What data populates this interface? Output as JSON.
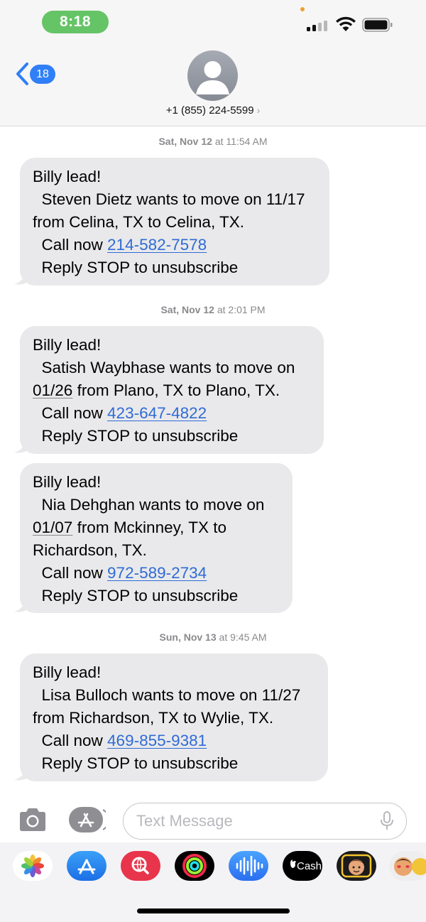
{
  "status_bar": {
    "time": "8:18"
  },
  "header": {
    "back_count": "18",
    "contact_number": "+1 (855) 224-5599",
    "contact_chevron": "›"
  },
  "messages": [
    {
      "timestamp_day": "Sat, Nov 12",
      "timestamp_at": " at ",
      "timestamp_time": "11:54 AM",
      "line1": "Billy lead!",
      "line2": "  Steven Dietz wants to move on 11/17",
      "line3": "from Celina, TX to Celina, TX.",
      "call_prefix": "  Call now ",
      "phone": "214-582-7578",
      "reply": "  Reply STOP to unsubscribe"
    },
    {
      "timestamp_day": "Sat, Nov 12",
      "timestamp_at": " at ",
      "timestamp_time": "2:01 PM",
      "line1": "Billy lead!",
      "line2": "  Satish Waybhase wants to move on",
      "date": "01/26",
      "line3_rest": " from Plano, TX to Plano, TX.",
      "call_prefix": "  Call now ",
      "phone": "423-647-4822",
      "reply": "  Reply STOP to unsubscribe"
    },
    {
      "line1": "Billy lead!",
      "line2": "  Nia Dehghan wants to move on",
      "date": "01/07",
      "line3_rest": " from Mckinney, TX to",
      "line4": "Richardson, TX.",
      "call_prefix": "  Call now ",
      "phone": "972-589-2734",
      "reply": "  Reply STOP to unsubscribe"
    },
    {
      "timestamp_day": "Sun, Nov 13",
      "timestamp_at": " at ",
      "timestamp_time": "9:45 AM",
      "line1": "Billy lead!",
      "line2": "  Lisa Bulloch wants to move on 11/27",
      "line3": "from Richardson, TX to Wylie, TX.",
      "call_prefix": "  Call now ",
      "phone": "469-855-9381",
      "reply": "  Reply STOP to unsubscribe"
    }
  ],
  "input": {
    "placeholder": "Text Message"
  },
  "app_drawer": {
    "icons": [
      "photos-icon",
      "app-store-icon",
      "search-images-icon",
      "activity-icon",
      "audio-message-icon",
      "apple-cash-icon",
      "memoji-icon",
      "animoji-icon"
    ],
    "cash_label": "Cash"
  },
  "colors": {
    "bubble": "#e9e9eb",
    "link": "#2f6bd6",
    "accent": "#2f7ff7",
    "time_pill": "#65c466"
  }
}
